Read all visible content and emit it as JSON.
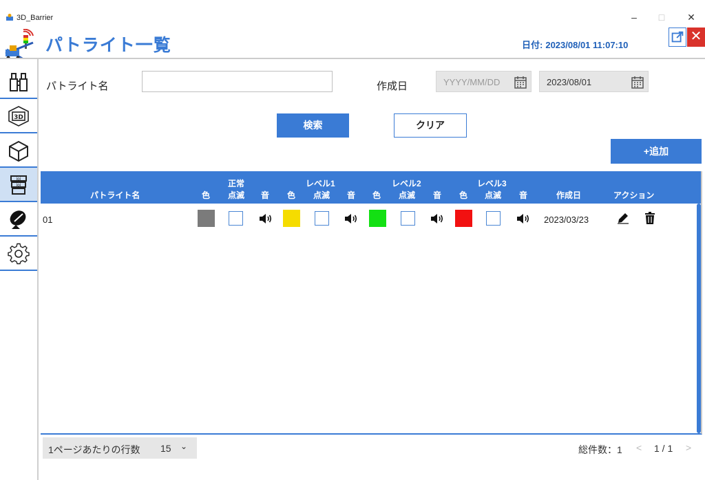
{
  "window": {
    "title": "3D_Barrier",
    "min": "–",
    "max": "□",
    "close": "✕"
  },
  "header": {
    "title": "パトライト一覧",
    "date_label": "日付:",
    "date_value": "2023/08/01 11:07:10",
    "close_glyph": "✕"
  },
  "sidebar": {
    "items": [
      {
        "icon": "binoculars-icon",
        "active": false
      },
      {
        "icon": "3d-view-icon",
        "active": false
      },
      {
        "icon": "cube-icon",
        "active": false
      },
      {
        "icon": "patlite-icon",
        "active": true
      },
      {
        "icon": "satellite-dish-icon",
        "active": false
      },
      {
        "icon": "gear-icon",
        "active": false
      }
    ]
  },
  "search": {
    "name_label": "パトライト名",
    "name_value": "",
    "date_label": "作成日",
    "date_from_placeholder": "YYYY/MM/DD",
    "date_to_value": "2023/08/01",
    "search_button": "検索",
    "clear_button": "クリア",
    "add_button": "+追加"
  },
  "table": {
    "headers": {
      "name": "パトライト名",
      "normal_group": "正常",
      "level1_group": "レベル1",
      "level2_group": "レベル2",
      "level3_group": "レベル3",
      "color": "色",
      "blink": "点滅",
      "sound": "音",
      "created": "作成日",
      "action": "アクション"
    },
    "rows": [
      {
        "name": "01",
        "normal": {
          "color": "#7b7b7b",
          "blink": false
        },
        "level1": {
          "color": "#f5dc00",
          "blink": false
        },
        "level2": {
          "color": "#13e013",
          "blink": false
        },
        "level3": {
          "color": "#f21111",
          "blink": false
        },
        "created": "2023/03/23"
      }
    ]
  },
  "footer": {
    "rows_per_page_label": "1ページあたりの行数",
    "rows_per_page_value": "15",
    "total_label": "総件数：1",
    "page_indicator": "1 / 1",
    "prev": "<",
    "next": ">"
  },
  "colors": {
    "accent": "#3a7bd5",
    "close_red": "#d9322b"
  }
}
